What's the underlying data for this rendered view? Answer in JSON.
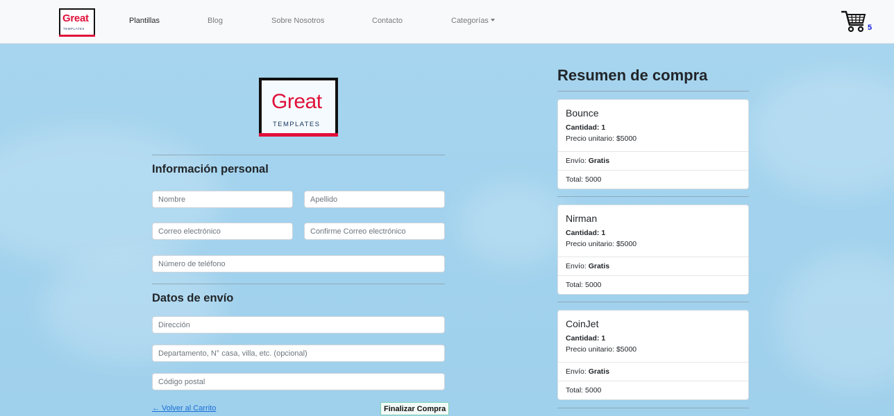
{
  "navbar": {
    "logo": {
      "word": "Great",
      "sub": "TEMPLATES"
    },
    "links": [
      {
        "label": "Plantillas",
        "active": true
      },
      {
        "label": "Blog"
      },
      {
        "label": "Sobre Nosotros"
      },
      {
        "label": "Contacto"
      },
      {
        "label": "Categorías"
      }
    ],
    "cart_count": "5"
  },
  "form": {
    "logo": {
      "word": "Great",
      "sub": "TEMPLATES"
    },
    "personal_title": "Información personal",
    "shipping_title": "Datos de envío",
    "placeholders": {
      "first_name": "Nombre",
      "last_name": "Apellido",
      "email": "Correo electrónico",
      "email_confirm": "Confirme Correo electrónico",
      "phone": "Número de teléfono",
      "address": "Dirección",
      "apartment": "Departamento, N° casa, villa, etc. (opcional)",
      "postal_code": "Código postal"
    },
    "back_link": "← Volver al Carrito",
    "submit_label": "Finalizar Compra"
  },
  "summary": {
    "title": "Resumen de compra",
    "items": [
      {
        "name": "Bounce",
        "quantity": "Cantidad: 1",
        "unit_price": "Precio unitario: $5000",
        "shipping_label": "Envío:",
        "shipping_value": "Gratis",
        "total": "Total: 5000"
      },
      {
        "name": "Nirman",
        "quantity": "Cantidad: 1",
        "unit_price": "Precio unitario: $5000",
        "shipping_label": "Envío:",
        "shipping_value": "Gratis",
        "total": "Total: 5000"
      },
      {
        "name": "CoinJet",
        "quantity": "Cantidad: 1",
        "unit_price": "Precio unitario: $5000",
        "shipping_label": "Envío:",
        "shipping_value": "Gratis",
        "total": "Total: 5000"
      }
    ]
  },
  "colors": {
    "brand_red": "#e0103a",
    "brand_navy": "#1a3560",
    "cart_count": "#0d1bd6",
    "link": "#1a6fd6"
  },
  "icons": {
    "cart": "shopping-cart-icon",
    "dropdown": "caret-down-icon"
  }
}
